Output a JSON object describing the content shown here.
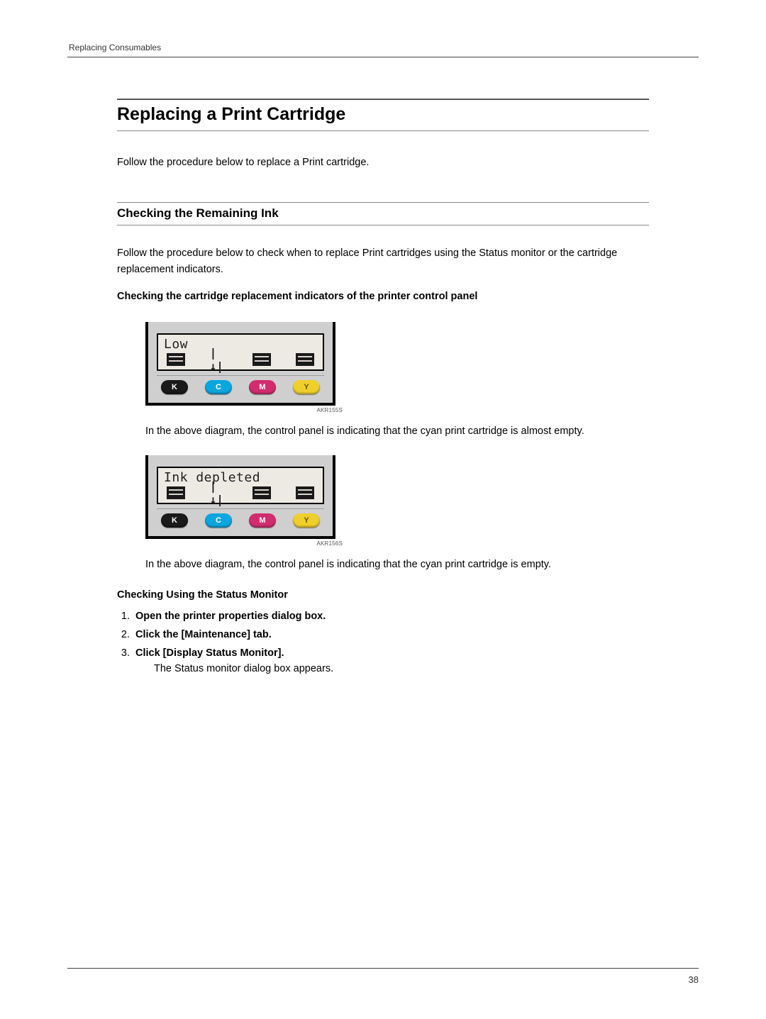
{
  "running_head": "Replacing Consumables",
  "h1": "Replacing a Print Cartridge",
  "intro": "Follow the procedure below to replace a Print cartridge.",
  "h2": "Checking the Remaining Ink",
  "h2_intro": "Follow the procedure below to check when to replace Print cartridges using the Status monitor or the cartridge replacement indicators.",
  "sub1": "Checking the cartridge replacement indicators of the printer control panel",
  "panels": [
    {
      "lcd_text": "Low",
      "icons": [
        "bar",
        "drop",
        "bar",
        "bar"
      ],
      "leds": [
        "K",
        "C",
        "M",
        "Y"
      ],
      "code": "AKR155S",
      "caption": "In the above diagram, the control panel is indicating that the cyan print cartridge is almost empty."
    },
    {
      "lcd_text": "Ink depleted",
      "icons": [
        "bar",
        "drop",
        "bar",
        "bar"
      ],
      "leds": [
        "K",
        "C",
        "M",
        "Y"
      ],
      "code": "AKR156S",
      "caption": "In the above diagram, the control panel is indicating that the cyan print cartridge is empty."
    }
  ],
  "sub2": "Checking Using the Status Monitor",
  "steps": [
    {
      "label": "Open the printer properties dialog box."
    },
    {
      "label": "Click the [Maintenance] tab."
    },
    {
      "label": "Click [Display Status Monitor].",
      "note": "The Status monitor dialog box appears."
    }
  ],
  "page_number": "38"
}
